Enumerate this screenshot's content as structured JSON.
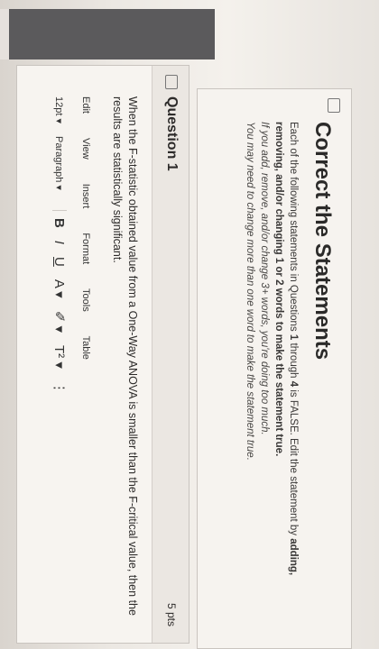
{
  "statements": {
    "title": "Correct the Statements",
    "line1_prefix": "Each of the following statements in Questions",
    "line1_bold": "1",
    "line1_mid": "through",
    "line1_bold2": "4",
    "line1_suffix": "is FALSE. Edit the statement by",
    "line1_bold3": "adding, removing, and/or changing 1 or 2 words to make the statement true.",
    "line2": "If you add, remove, and/or change 3+ words, you're doing too much.",
    "line3": "You may need to change more than one word to make the statement true."
  },
  "question": {
    "title": "Question 1",
    "points": "5 pts",
    "text": "When the F-statistic obtained value from a One-Way ANOVA is smaller than the F-critical value, then the results are statistically significant."
  },
  "editor": {
    "menu": [
      "Edit",
      "View",
      "Insert",
      "Format",
      "Tools",
      "Table"
    ],
    "font_size": "12pt",
    "paragraph": "Paragraph",
    "bold": "B",
    "italic": "I",
    "underline": "U",
    "text_color": "A",
    "highlight": "✐",
    "superscript": "T²",
    "more": "⋮"
  }
}
